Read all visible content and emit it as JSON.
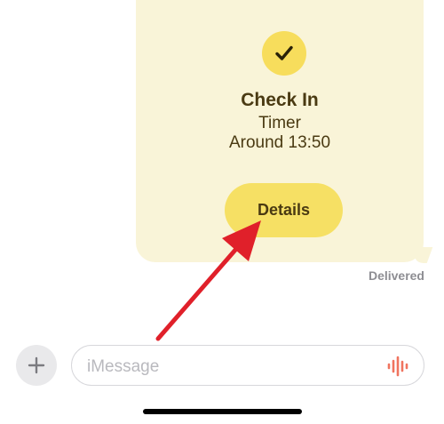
{
  "checkin": {
    "title": "Check In",
    "subtitle": "Timer",
    "time": "Around 13:50",
    "details_label": "Details",
    "badge_icon": "checkmark-icon",
    "card_color": "#f9f4d8",
    "accent_color": "#f7dd5c"
  },
  "message": {
    "status": "Delivered"
  },
  "composer": {
    "placeholder": "iMessage",
    "plus_icon": "plus-icon",
    "audio_icon": "waveform-icon",
    "audio_color": "#f0745f"
  },
  "annotation": {
    "arrow_color": "#e0202a"
  }
}
